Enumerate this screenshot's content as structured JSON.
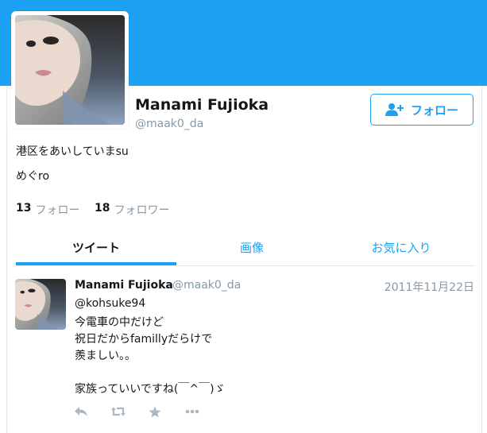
{
  "profile": {
    "name": "Manami Fujioka",
    "handle": "@maak0_da",
    "bio_line1": "港区をあいしていまsu",
    "bio_line2": "めぐro",
    "follow_button_label": "フォロー"
  },
  "stats": {
    "following_count": "13",
    "following_label": "フォロー",
    "followers_count": "18",
    "followers_label": "フォロワー"
  },
  "tabs": [
    {
      "label": "ツイート",
      "active": true
    },
    {
      "label": "画像",
      "active": false
    },
    {
      "label": "お気に入り",
      "active": false
    }
  ],
  "tweet": {
    "name": "Manami Fujioka",
    "handle": "@maak0_da",
    "date": "2011年11月22日",
    "lines": [
      "@kohsuke94",
      "今電車の中だけど",
      "祝日だからfamillyだらけで",
      "羨ましい。。",
      "",
      "家族っていいですね(￣^￣)ゞ"
    ],
    "actions": [
      "reply-icon",
      "retweet-icon",
      "favorite-icon",
      "more-icon"
    ]
  },
  "colors": {
    "banner": "#1da1f2",
    "accent": "#1da1f2",
    "muted_text": "#8899a6",
    "action_icon": "#aab8c2"
  }
}
